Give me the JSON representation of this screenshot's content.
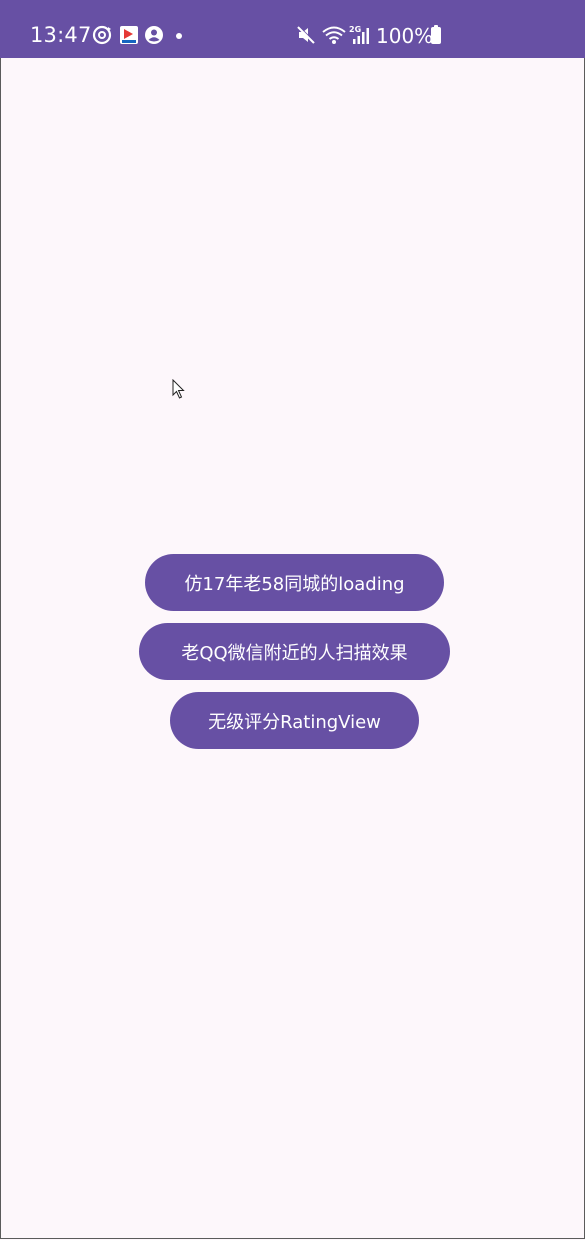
{
  "status_bar": {
    "time": "13:47",
    "battery_percent": "100%",
    "network_label": "2G",
    "background_color": "#6750A4",
    "icons": [
      "sync-icon",
      "app-notification-icon",
      "account-icon",
      "notification-dot",
      "mute-icon",
      "wifi-icon",
      "signal-icon",
      "battery-icon"
    ]
  },
  "main": {
    "background_color": "#FDF7FB",
    "buttons": [
      {
        "label": "仿17年老58同城的loading"
      },
      {
        "label": "老QQ微信附近的人扫描效果"
      },
      {
        "label": "无级评分RatingView"
      }
    ],
    "accent_color": "#6750A4"
  }
}
